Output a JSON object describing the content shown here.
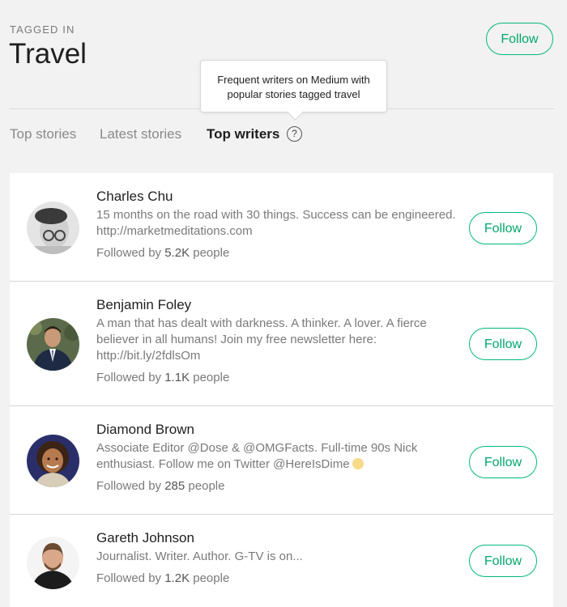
{
  "header": {
    "tagged_label": "TAGGED IN",
    "title": "Travel",
    "follow_label": "Follow"
  },
  "tooltip": {
    "text_line1": "Frequent writers on Medium with",
    "text_line2": "popular stories tagged travel"
  },
  "tabs": [
    {
      "label": "Top stories",
      "active": false
    },
    {
      "label": "Latest stories",
      "active": false
    },
    {
      "label": "Top writers",
      "active": true
    }
  ],
  "help_icon": {
    "glyph": "?",
    "icon": "help-circle-icon"
  },
  "writers": [
    {
      "name": "Charles Chu",
      "bio": "15 months on the road with 30 things. Success can be engineered. http://marketmeditations.com",
      "followed_prefix": "Followed by",
      "followers": "5.2K",
      "followed_suffix": "people",
      "follow_label": "Follow"
    },
    {
      "name": "Benjamin Foley",
      "bio": "A man that has dealt with darkness. A thinker. A lover. A fierce believer in all humans! Join my free newsletter here: http://bit.ly/2fdlsOm",
      "followed_prefix": "Followed by",
      "followers": "1.1K",
      "followed_suffix": "people",
      "follow_label": "Follow"
    },
    {
      "name": "Diamond Brown",
      "bio": "Associate Editor @Dose & @OMGFacts. Full-time 90s Nick enthusiast. Follow me on Twitter @HereIsDime",
      "followed_prefix": "Followed by",
      "followers": "285",
      "followed_suffix": "people",
      "follow_label": "Follow"
    },
    {
      "name": "Gareth Johnson",
      "bio": "Journalist. Writer. Author. G-TV is on...",
      "followed_prefix": "Followed by",
      "followers": "1.2K",
      "followed_suffix": "people",
      "follow_label": "Follow"
    }
  ],
  "colors": {
    "accent": "#03b876",
    "background": "#f2f2f2",
    "card": "#ffffff",
    "muted_text": "#7a7a7a"
  }
}
